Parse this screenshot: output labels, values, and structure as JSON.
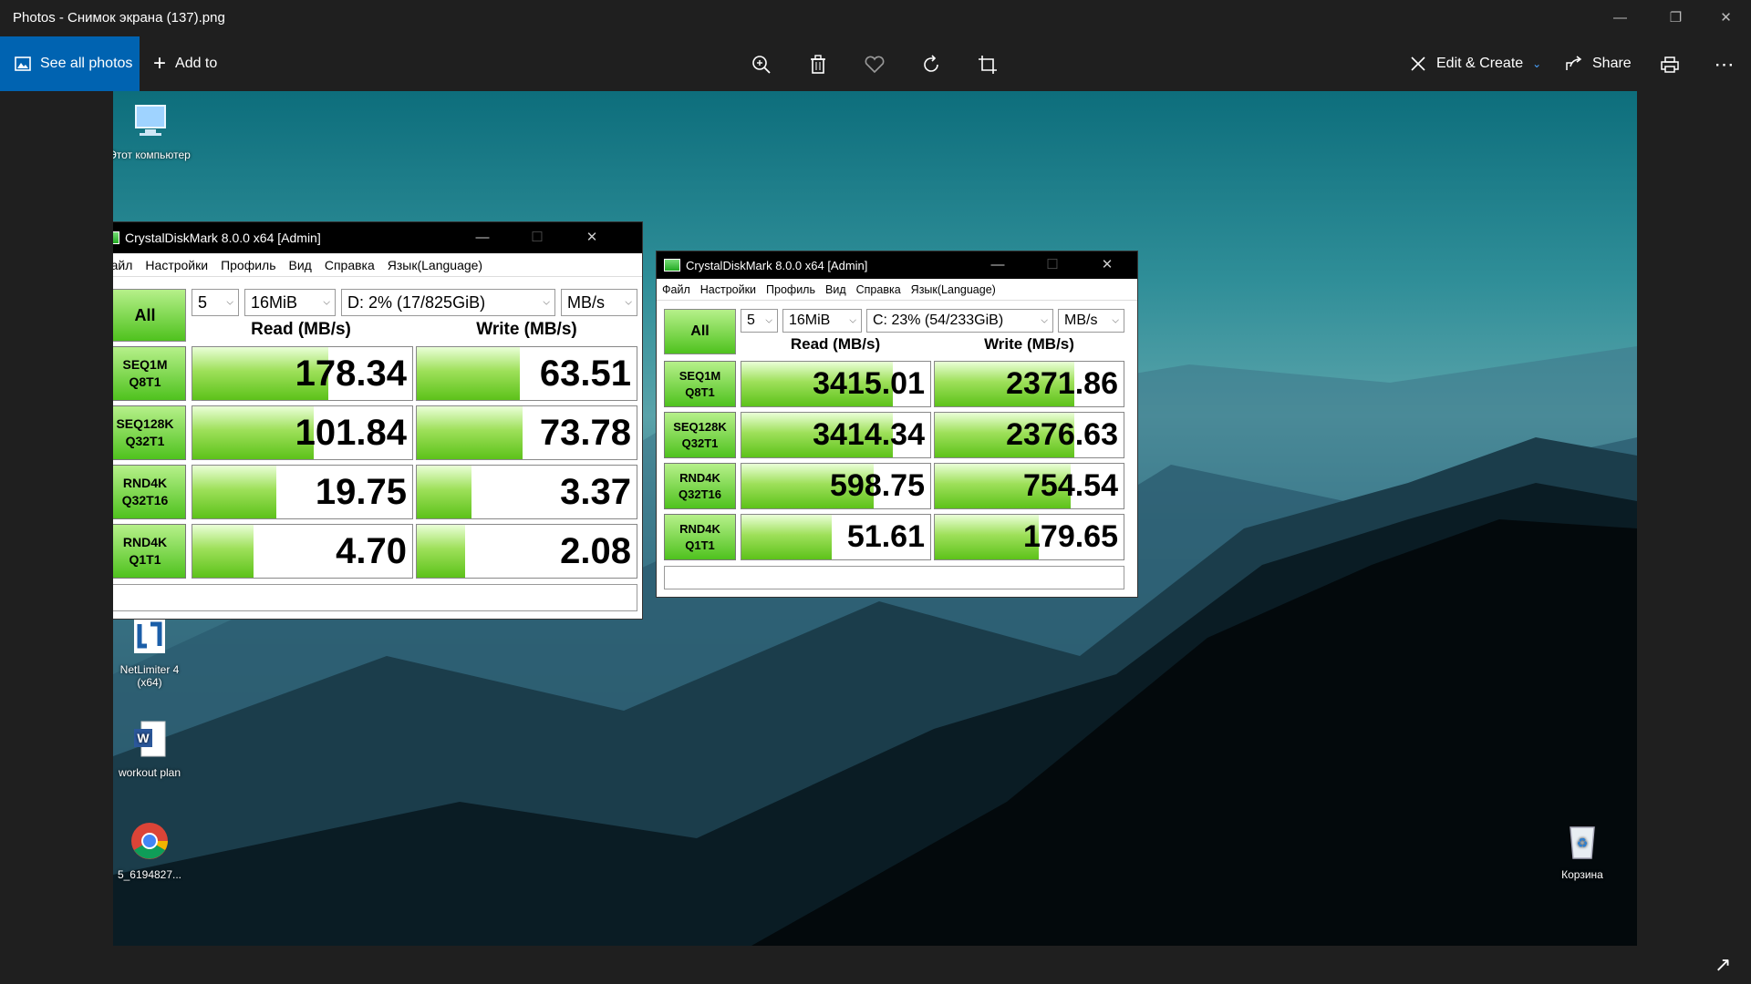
{
  "app": {
    "title": "Photos - Снимок экрана (137).png",
    "see_all": "See all photos",
    "add_to": "Add to",
    "edit_create": "Edit & Create",
    "share": "Share"
  },
  "desktop": {
    "icons": [
      {
        "label": "Этот компьютер",
        "icon": "computer-icon"
      },
      {
        "label": "NetLimiter 4 (x64)",
        "icon": "netlimiter-icon"
      },
      {
        "label": "workout plan",
        "icon": "word-document-icon"
      },
      {
        "label": "5_6194827...",
        "icon": "chrome-icon"
      },
      {
        "label": "Корзина",
        "icon": "recycle-bin-icon"
      }
    ]
  },
  "cdm_left": {
    "title": "CrystalDiskMark 8.0.0 x64 [Admin]",
    "menu": [
      "Файл",
      "Настройки",
      "Профиль",
      "Вид",
      "Справка",
      "Язык(Language)"
    ],
    "all_label": "All",
    "count": "5",
    "size": "16MiB",
    "drive": "D: 2% (17/825GiB)",
    "unit": "MB/s",
    "read_header": "Read (MB/s)",
    "write_header": "Write (MB/s)",
    "rows": [
      {
        "l1": "SEQ1M",
        "l2": "Q8T1",
        "read": "178.34",
        "write": "63.51",
        "read_fill": 0.62,
        "write_fill": 0.47
      },
      {
        "l1": "SEQ128K",
        "l2": "Q32T1",
        "read": "101.84",
        "write": "73.78",
        "read_fill": 0.55,
        "write_fill": 0.48
      },
      {
        "l1": "RND4K",
        "l2": "Q32T16",
        "read": "19.75",
        "write": "3.37",
        "read_fill": 0.38,
        "write_fill": 0.25
      },
      {
        "l1": "RND4K",
        "l2": "Q1T1",
        "read": "4.70",
        "write": "2.08",
        "read_fill": 0.28,
        "write_fill": 0.22
      }
    ]
  },
  "cdm_right": {
    "title": "CrystalDiskMark 8.0.0 x64 [Admin]",
    "menu": [
      "Файл",
      "Настройки",
      "Профиль",
      "Вид",
      "Справка",
      "Язык(Language)"
    ],
    "all_label": "All",
    "count": "5",
    "size": "16MiB",
    "drive": "C: 23% (54/233GiB)",
    "unit": "MB/s",
    "read_header": "Read (MB/s)",
    "write_header": "Write (MB/s)",
    "rows": [
      {
        "l1": "SEQ1M",
        "l2": "Q8T1",
        "read": "3415.01",
        "write": "2371.86",
        "read_fill": 0.8,
        "write_fill": 0.74
      },
      {
        "l1": "SEQ128K",
        "l2": "Q32T1",
        "read": "3414.34",
        "write": "2376.63",
        "read_fill": 0.8,
        "write_fill": 0.74
      },
      {
        "l1": "RND4K",
        "l2": "Q32T16",
        "read": "598.75",
        "write": "754.54",
        "read_fill": 0.7,
        "write_fill": 0.72
      },
      {
        "l1": "RND4K",
        "l2": "Q1T1",
        "read": "51.61",
        "write": "179.65",
        "read_fill": 0.48,
        "write_fill": 0.55
      }
    ]
  }
}
